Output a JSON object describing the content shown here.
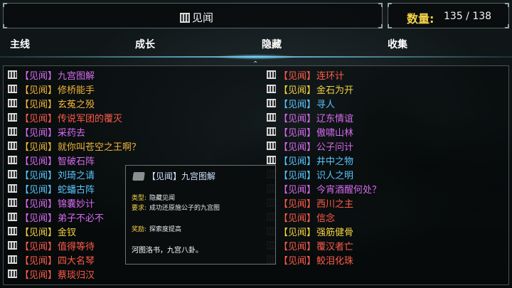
{
  "header": {
    "title": "见闻"
  },
  "counter": {
    "label": "数量:",
    "value": "135 / 138"
  },
  "tabs": [
    {
      "label": "主线"
    },
    {
      "label": "成长"
    },
    {
      "label": "隐藏"
    },
    {
      "label": "收集"
    }
  ],
  "active_tab": "隐藏",
  "colors": {
    "purple": "#d76af0",
    "orange": "#f3b43a",
    "red": "#ff5b4a",
    "blue": "#58c6ff",
    "gold": "#f2d040"
  },
  "left_list": [
    {
      "tag": "【见闻】",
      "name": "九宫图解",
      "color": "purple"
    },
    {
      "tag": "【见闻】",
      "name": "修桥能手",
      "color": "orange"
    },
    {
      "tag": "【见闻】",
      "name": "玄菟之殁",
      "color": "orange"
    },
    {
      "tag": "【见闻】",
      "name": "传说军团的覆灭",
      "color": "red"
    },
    {
      "tag": "【见闻】",
      "name": "采药去",
      "color": "purple"
    },
    {
      "tag": "【见闻】",
      "name": "就你叫苍空之王啊？",
      "color": "orange"
    },
    {
      "tag": "【见闻】",
      "name": "智破石阵",
      "color": "purple"
    },
    {
      "tag": "【见闻】",
      "name": "刘琦之请",
      "color": "blue"
    },
    {
      "tag": "【见闻】",
      "name": "蛇蟠古阵",
      "color": "blue"
    },
    {
      "tag": "【见闻】",
      "name": "锦囊妙计",
      "color": "purple"
    },
    {
      "tag": "【见闻】",
      "name": "弟子不必不",
      "color": "purple"
    },
    {
      "tag": "【见闻】",
      "name": "金钗",
      "color": "gold"
    },
    {
      "tag": "【见闻】",
      "name": "值得等待",
      "color": "red"
    },
    {
      "tag": "【见闻】",
      "name": "四大名琴",
      "color": "red"
    },
    {
      "tag": "【见闻】",
      "name": "蔡琰归汉",
      "color": "red"
    }
  ],
  "right_list": [
    {
      "tag": "【见闻】",
      "name": "连环计",
      "color": "red"
    },
    {
      "tag": "【见闻】",
      "name": "金石为开",
      "color": "gold"
    },
    {
      "tag": "【见闻】",
      "name": "寻人",
      "color": "blue"
    },
    {
      "tag": "【见闻】",
      "name": "辽东情谊",
      "color": "purple"
    },
    {
      "tag": "【见闻】",
      "name": "傲啸山林",
      "color": "purple"
    },
    {
      "tag": "【见闻】",
      "name": "公子问计",
      "color": "purple"
    },
    {
      "tag": "【见闻】",
      "name": "井中之物",
      "color": "blue"
    },
    {
      "tag": "【见闻】",
      "name": "识人之明",
      "color": "blue"
    },
    {
      "tag": "【见闻】",
      "name": "今宵酒醒何处？",
      "color": "purple"
    },
    {
      "tag": "【见闻】",
      "name": "西川之主",
      "color": "red"
    },
    {
      "tag": "【见闻】",
      "name": "信念",
      "color": "red"
    },
    {
      "tag": "【见闻】",
      "name": "强筋健骨",
      "color": "gold"
    },
    {
      "tag": "【见闻】",
      "name": "覆汉者亡",
      "color": "red"
    },
    {
      "tag": "【见闻】",
      "name": "鲛泪化珠",
      "color": "red"
    }
  ],
  "popup": {
    "title": "【见闻】九宫图解",
    "type_key": "类型:",
    "type_val": "隐藏见闻",
    "req_key": "要求:",
    "req_val": "成功还原施公子的九宫图",
    "reward_key": "奖励:",
    "reward_val": "探索度提高",
    "poem": "河图洛书，九宫八卦。"
  }
}
